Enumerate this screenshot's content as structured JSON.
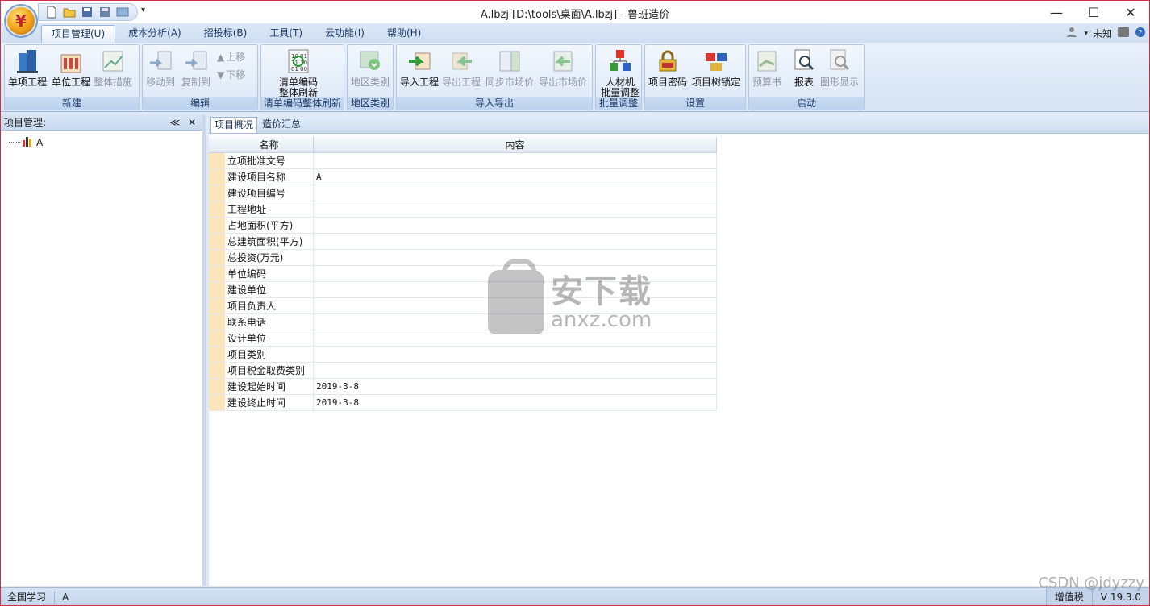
{
  "window": {
    "title": "A.lbzj [D:\\tools\\桌面\\A.lbzj] - 鲁班造价"
  },
  "menu": {
    "tabs": [
      "项目管理(U)",
      "成本分析(A)",
      "招投标(B)",
      "工具(T)",
      "云功能(I)",
      "帮助(H)"
    ],
    "user": "未知"
  },
  "ribbon": {
    "groups": [
      {
        "label": "新建",
        "buttons": [
          "单项工程",
          "单位工程",
          "整体措施"
        ]
      },
      {
        "label": "编辑",
        "buttons": [
          "移动到",
          "复制到"
        ],
        "small": [
          "上移",
          "下移"
        ]
      },
      {
        "label": "清单编码整体刷新",
        "buttons": [
          "清单编码",
          "整体刷新"
        ]
      },
      {
        "label": "地区类别",
        "buttons": [
          "地区类别"
        ]
      },
      {
        "label": "导入导出",
        "buttons": [
          "导入工程",
          "导出工程",
          "同步市场价",
          "导出市场价"
        ]
      },
      {
        "label": "批量调整",
        "buttons": [
          "人材机",
          "批量调整"
        ]
      },
      {
        "label": "设置",
        "buttons": [
          "项目密码",
          "项目树锁定"
        ]
      },
      {
        "label": "启动",
        "buttons": [
          "预算书",
          "报表",
          "图形显示"
        ]
      }
    ]
  },
  "left_panel": {
    "title": "项目管理:",
    "tree": [
      {
        "label": "A"
      }
    ]
  },
  "content": {
    "tabs": [
      "项目概况",
      "造价汇总"
    ],
    "grid": {
      "headers": [
        "名称",
        "内容"
      ],
      "rows": [
        {
          "name": "立项批准文号",
          "value": ""
        },
        {
          "name": "建设项目名称",
          "value": "A"
        },
        {
          "name": "建设项目编号",
          "value": ""
        },
        {
          "name": "工程地址",
          "value": ""
        },
        {
          "name": "占地面积(平方)",
          "value": ""
        },
        {
          "name": "总建筑面积(平方)",
          "value": ""
        },
        {
          "name": "总投资(万元)",
          "value": ""
        },
        {
          "name": "单位编码",
          "value": ""
        },
        {
          "name": "建设单位",
          "value": ""
        },
        {
          "name": "项目负责人",
          "value": ""
        },
        {
          "name": "联系电话",
          "value": ""
        },
        {
          "name": "设计单位",
          "value": ""
        },
        {
          "name": "项目类别",
          "value": ""
        },
        {
          "name": "项目税金取费类别",
          "value": ""
        },
        {
          "name": "建设起始时间",
          "value": "2019-3-8"
        },
        {
          "name": "建设终止时间",
          "value": "2019-3-8"
        }
      ]
    }
  },
  "watermark": {
    "line1": "安下载",
    "line2": "anxz.com"
  },
  "status": {
    "left": "全国学习",
    "project": "A",
    "tax": "增值税",
    "version": "V 19.3.0"
  },
  "csdn": "CSDN @jdyzzy"
}
